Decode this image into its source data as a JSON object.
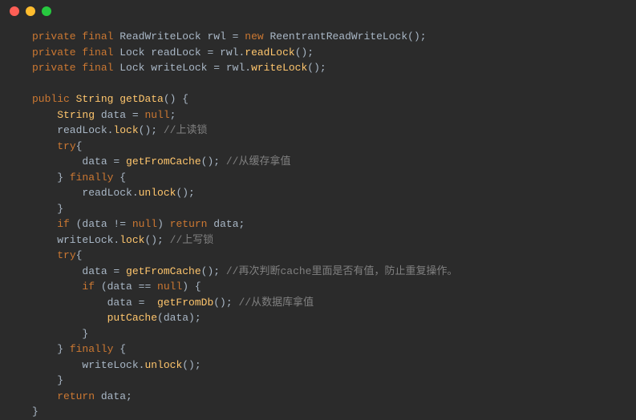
{
  "titlebar": {
    "buttons": [
      "close",
      "minimize",
      "maximize"
    ]
  },
  "code": {
    "lines": [
      {
        "tokens": [
          {
            "t": "private",
            "c": "kw"
          },
          {
            "t": " "
          },
          {
            "t": "final",
            "c": "kw"
          },
          {
            "t": " "
          },
          {
            "t": "ReadWriteLock rwl = "
          },
          {
            "t": "new",
            "c": "kw"
          },
          {
            "t": " "
          },
          {
            "t": "ReentrantReadWriteLock",
            "c": "class"
          },
          {
            "t": "();"
          }
        ]
      },
      {
        "tokens": [
          {
            "t": "private",
            "c": "kw"
          },
          {
            "t": " "
          },
          {
            "t": "final",
            "c": "kw"
          },
          {
            "t": " "
          },
          {
            "t": "Lock readLock = rwl."
          },
          {
            "t": "readLock",
            "c": "fncall"
          },
          {
            "t": "();"
          }
        ]
      },
      {
        "tokens": [
          {
            "t": "private",
            "c": "kw"
          },
          {
            "t": " "
          },
          {
            "t": "final",
            "c": "kw"
          },
          {
            "t": " "
          },
          {
            "t": "Lock writeLock = rwl."
          },
          {
            "t": "writeLock",
            "c": "fncall"
          },
          {
            "t": "();"
          }
        ]
      },
      {
        "tokens": [
          {
            "t": ""
          }
        ]
      },
      {
        "tokens": [
          {
            "t": "public",
            "c": "kw"
          },
          {
            "t": " "
          },
          {
            "t": "String",
            "c": "def"
          },
          {
            "t": " "
          },
          {
            "t": "getData",
            "c": "def"
          },
          {
            "t": "() {"
          }
        ]
      },
      {
        "tokens": [
          {
            "t": "    "
          },
          {
            "t": "String",
            "c": "def"
          },
          {
            "t": " data = "
          },
          {
            "t": "null",
            "c": "kw"
          },
          {
            "t": ";"
          }
        ]
      },
      {
        "tokens": [
          {
            "t": "    readLock."
          },
          {
            "t": "lock",
            "c": "fncall"
          },
          {
            "t": "(); "
          },
          {
            "t": "//上读锁",
            "c": "comment"
          }
        ]
      },
      {
        "tokens": [
          {
            "t": "    "
          },
          {
            "t": "try",
            "c": "kw"
          },
          {
            "t": "{"
          }
        ]
      },
      {
        "tokens": [
          {
            "t": "        data = "
          },
          {
            "t": "getFromCache",
            "c": "fncall"
          },
          {
            "t": "(); "
          },
          {
            "t": "//从缓存拿值",
            "c": "comment"
          }
        ]
      },
      {
        "tokens": [
          {
            "t": "    } "
          },
          {
            "t": "finally",
            "c": "kw"
          },
          {
            "t": " {"
          }
        ]
      },
      {
        "tokens": [
          {
            "t": "        readLock."
          },
          {
            "t": "unlock",
            "c": "fncall"
          },
          {
            "t": "();"
          }
        ]
      },
      {
        "tokens": [
          {
            "t": "    }"
          }
        ]
      },
      {
        "tokens": [
          {
            "t": "    "
          },
          {
            "t": "if",
            "c": "kw"
          },
          {
            "t": " (data != "
          },
          {
            "t": "null",
            "c": "kw"
          },
          {
            "t": ") "
          },
          {
            "t": "return",
            "c": "kw"
          },
          {
            "t": " data;"
          }
        ]
      },
      {
        "tokens": [
          {
            "t": "    writeLock."
          },
          {
            "t": "lock",
            "c": "fncall"
          },
          {
            "t": "(); "
          },
          {
            "t": "//上写锁",
            "c": "comment"
          }
        ]
      },
      {
        "tokens": [
          {
            "t": "    "
          },
          {
            "t": "try",
            "c": "kw"
          },
          {
            "t": "{"
          }
        ]
      },
      {
        "tokens": [
          {
            "t": "        data = "
          },
          {
            "t": "getFromCache",
            "c": "fncall"
          },
          {
            "t": "(); "
          },
          {
            "t": "//再次判断cache里面是否有值，防止重复操作。",
            "c": "comment"
          }
        ]
      },
      {
        "tokens": [
          {
            "t": "        "
          },
          {
            "t": "if",
            "c": "kw"
          },
          {
            "t": " (data == "
          },
          {
            "t": "null",
            "c": "kw"
          },
          {
            "t": ") {"
          }
        ]
      },
      {
        "tokens": [
          {
            "t": "            data =  "
          },
          {
            "t": "getFromDb",
            "c": "fncall"
          },
          {
            "t": "(); "
          },
          {
            "t": "//从数据库拿值",
            "c": "comment"
          }
        ]
      },
      {
        "tokens": [
          {
            "t": "            "
          },
          {
            "t": "putCache",
            "c": "fncall"
          },
          {
            "t": "(data);"
          }
        ]
      },
      {
        "tokens": [
          {
            "t": "        }"
          }
        ]
      },
      {
        "tokens": [
          {
            "t": "    } "
          },
          {
            "t": "finally",
            "c": "kw"
          },
          {
            "t": " {"
          }
        ]
      },
      {
        "tokens": [
          {
            "t": "        writeLock."
          },
          {
            "t": "unlock",
            "c": "fncall"
          },
          {
            "t": "();"
          }
        ]
      },
      {
        "tokens": [
          {
            "t": "    }"
          }
        ]
      },
      {
        "tokens": [
          {
            "t": "    "
          },
          {
            "t": "return",
            "c": "kw"
          },
          {
            "t": " data;"
          }
        ]
      },
      {
        "tokens": [
          {
            "t": "}"
          }
        ]
      }
    ]
  }
}
